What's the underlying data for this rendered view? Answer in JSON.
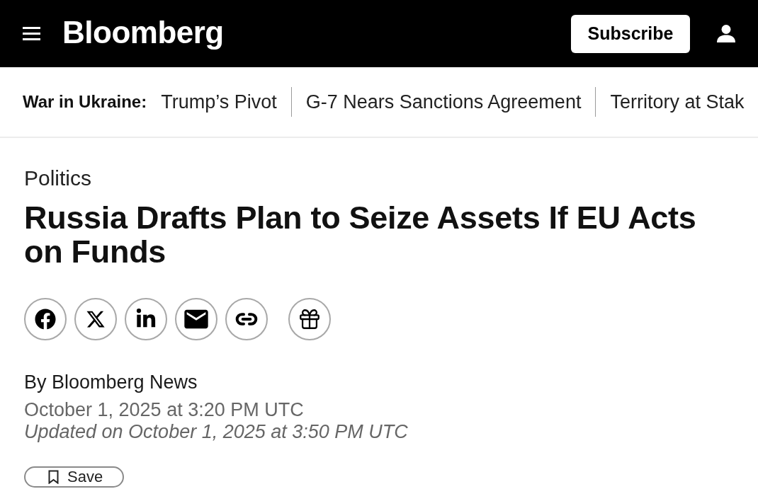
{
  "header": {
    "logo": "Bloomberg",
    "subscribe_button": "Subscribe"
  },
  "topic_bar": {
    "label": "War in Ukraine:",
    "links": [
      "Trump’s Pivot",
      "G-7 Nears Sanctions Agreement",
      "Territory at Stak"
    ]
  },
  "article": {
    "section": "Politics",
    "headline": "Russia Drafts Plan to Seize Assets If EU Acts on Funds",
    "byline": "By Bloomberg News",
    "published": "October 1, 2025 at 3:20 PM UTC",
    "updated": "Updated on October 1, 2025 at 3:50 PM UTC",
    "save_button": "Save"
  }
}
